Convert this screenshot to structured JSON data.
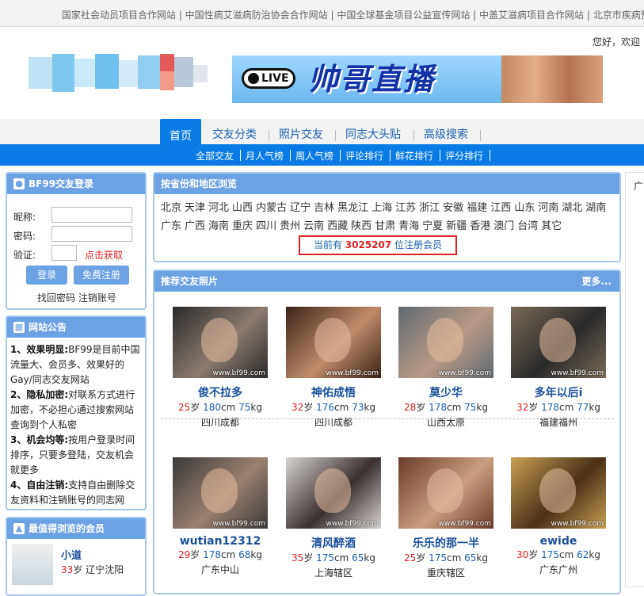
{
  "top_links": "国家社会动员项目合作网站 | 中国性病艾滋病防治协会合作网站 | 中国全球基金项目公益宣传网站 | 中盖艾滋病项目合作网站 | 北京市疾病预",
  "welcome": "您好，欢迎",
  "banner": {
    "live": "LIVE",
    "title": "帅哥直播"
  },
  "nav": {
    "tabs": [
      "首页",
      "交友分类",
      "照片交友",
      "同志大头贴",
      "高级搜索"
    ]
  },
  "subnav": [
    "全部交友",
    "月人气榜",
    "周人气榜",
    "评论排行",
    "鲜花排行",
    "评分排行"
  ],
  "login": {
    "title": "BF99交友登录",
    "nickname_label": "昵称:",
    "password_label": "密码:",
    "verify_label": "验证:",
    "get_code": "点击获取",
    "login_btn": "登录",
    "register_btn": "免费注册",
    "forgot": "找回密码",
    "cancel": "注销账号"
  },
  "notice": {
    "title": "网站公告",
    "items": [
      {
        "head": "1、效果明显:",
        "body": "BF99是目前中国流量大、会员多、效果好的Gay/同志交友网站"
      },
      {
        "head": "2、隐私加密:",
        "body": "对联系方式进行加密，不必担心通过搜索网站查询到个人私密"
      },
      {
        "head": "3、机会均等:",
        "body": "按用户登录时间排序，只要多登陆，交友机会就更多"
      },
      {
        "head": "4、自由注销:",
        "body": "支持自由删除交友资料和注销账号的同志网"
      }
    ]
  },
  "hot": {
    "title": "最值得浏览的会员",
    "items": [
      {
        "name": "小道",
        "age": "33",
        "age_unit": "岁",
        "city": "辽宁沈阳"
      }
    ]
  },
  "region": {
    "title": "按省份和地区浏览",
    "list": [
      "北京",
      "天津",
      "河北",
      "山西",
      "内蒙古",
      "辽宁",
      "吉林",
      "黑龙江",
      "上海",
      "江苏",
      "浙江",
      "安徽",
      "福建",
      "江西",
      "山东",
      "河南",
      "湖北",
      "湖南",
      "广东",
      "广西",
      "海南",
      "重庆",
      "四川",
      "贵州",
      "云南",
      "西藏",
      "陕西",
      "甘肃",
      "青海",
      "宁夏",
      "新疆",
      "香港",
      "澳门",
      "台湾",
      "其它"
    ],
    "count_prefix": "当前有",
    "count": "3025207",
    "count_suffix": "位注册会员"
  },
  "photos": {
    "title": "推荐交友照片",
    "more": "更多...",
    "watermark": "www.bf99.com",
    "cards": [
      {
        "nick": "俊不拉多",
        "age": "25",
        "height": "180",
        "weight": "75",
        "city": "四川成都",
        "colors": [
          "#2a2a2a",
          "#8b7b70"
        ]
      },
      {
        "nick": "神佑成悟",
        "age": "32",
        "height": "176",
        "weight": "73",
        "city": "四川成都",
        "colors": [
          "#3a2418",
          "#c08a6a"
        ]
      },
      {
        "nick": "莫少华",
        "age": "28",
        "height": "178",
        "weight": "75",
        "city": "山西太原",
        "colors": [
          "#5f6a72",
          "#b89a86"
        ]
      },
      {
        "nick": "多年以后i",
        "age": "32",
        "height": "178",
        "weight": "77",
        "city": "福建福州",
        "colors": [
          "#7a6a58",
          "#2a2a2a"
        ]
      },
      {
        "nick": "wutian12312",
        "age": "29",
        "height": "178",
        "weight": "68",
        "city": "广东中山",
        "colors": [
          "#3a3a3a",
          "#9a8070"
        ]
      },
      {
        "nick": "清风醉酒",
        "age": "35",
        "height": "175",
        "weight": "65",
        "city": "上海辖区",
        "colors": [
          "#d8d4d0",
          "#3a3030"
        ]
      },
      {
        "nick": "乐乐的那一半",
        "age": "25",
        "height": "175",
        "weight": "65",
        "city": "重庆辖区",
        "colors": [
          "#6a3a2a",
          "#c9a080"
        ]
      },
      {
        "nick": "ewide",
        "age": "30",
        "height": "175",
        "weight": "62",
        "city": "广东广州",
        "colors": [
          "#c8a050",
          "#4a3018"
        ]
      }
    ],
    "units": {
      "age": "岁",
      "height": "cm",
      "weight": "kg"
    }
  },
  "right_box": "广"
}
